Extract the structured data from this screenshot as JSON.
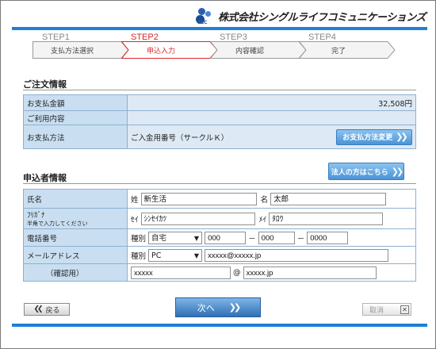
{
  "brand": {
    "mark": "SLC",
    "name": "株式会社シングルライフコミュニケーションズ"
  },
  "steps": [
    {
      "step": "STEP1",
      "label": "支払方法選択",
      "active": false
    },
    {
      "step": "STEP2",
      "label": "申込入力",
      "active": true
    },
    {
      "step": "STEP3",
      "label": "内容確認",
      "active": false
    },
    {
      "step": "STEP4",
      "label": "完了",
      "active": false
    }
  ],
  "order": {
    "title": "ご注文情報",
    "amount_label": "お支払金額",
    "amount_value": "32,508円",
    "usage_label": "ご利用内容",
    "usage_value": "",
    "method_label": "お支払方法",
    "method_value": "ご入金用番号（サークルＫ）",
    "change_button": "お支払方法変更"
  },
  "applicant": {
    "title": "申込者情報",
    "corporate_button": "法人の方はこちら",
    "name_label": "氏名",
    "sei_label": "姓",
    "sei_value": "新生活",
    "mei_label": "名",
    "mei_value": "太郎",
    "kana_label": "ﾌﾘｶﾞﾅ",
    "kana_note": "半角で入力してください",
    "kana_sei_label": "ｾｲ",
    "kana_sei_value": "ｼﾝｾｲｶﾂ",
    "kana_mei_label": "ﾒｲ",
    "kana_mei_value": "ﾀﾛｳ",
    "phone_label": "電話番号",
    "phone_type_label": "種別",
    "phone_type_value": "自宅",
    "phone_1": "000",
    "phone_2": "000",
    "phone_3": "0000",
    "phone_sep": "－",
    "email_label": "メールアドレス",
    "email_type_label": "種別",
    "email_type_value": "PC",
    "email_value": "xxxxx@xxxxx.jp",
    "confirm_label": "（確認用）",
    "confirm_local": "xxxxx",
    "confirm_at": "@",
    "confirm_domain": "xxxxx.jp"
  },
  "nav": {
    "back": "戻る",
    "next": "次へ",
    "cancel": "取消"
  },
  "colors": {
    "accent": "#1e7fd8",
    "active_step": "#d8262c",
    "label_bg": "#c9dff1",
    "value_bg": "#dde9f4"
  }
}
